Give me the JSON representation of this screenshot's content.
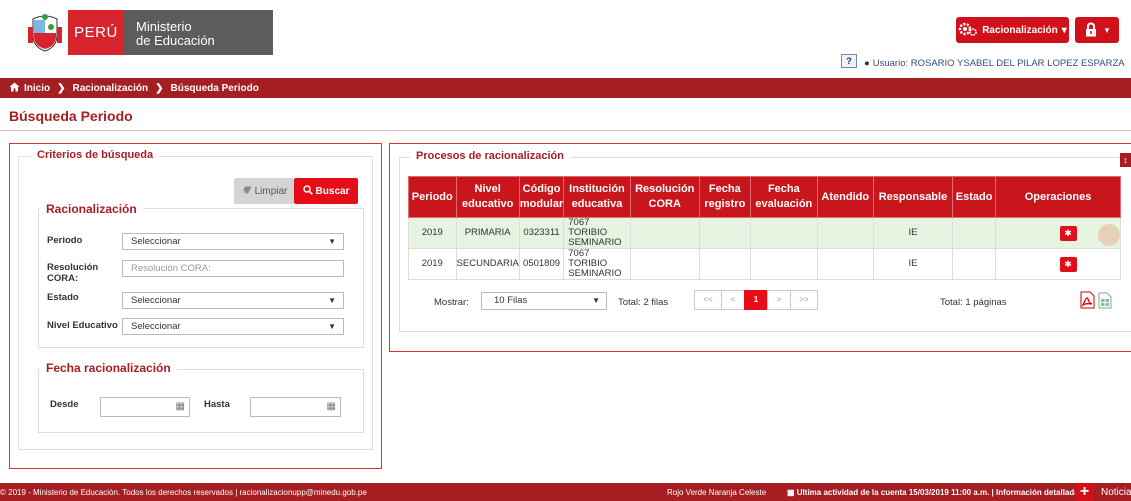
{
  "header": {
    "logo_country": "PERÚ",
    "logo_ministry_line1": "Ministerio",
    "logo_ministry_line2": "de Educación",
    "racionalizacion_menu": "Racionalización",
    "help_label": "?",
    "user_label": "Usuario: ROSARIO YSABEL DEL PILAR LOPEZ ESPARZA"
  },
  "breadcrumb": [
    "Inicio",
    "Racionalización",
    "Búsqueda Periodo"
  ],
  "page_title": "Búsqueda Periodo",
  "criteria": {
    "legend": "Criterios de búsqueda",
    "clear_label": "Limpiar",
    "search_label": "Buscar",
    "racionalizacion_legend": "Racionalización",
    "periodo_label": "Periodo",
    "periodo_value": "Seleccionar",
    "resolucion_label_1": "Resolución",
    "resolucion_label_2": "CORA:",
    "resolucion_placeholder": "Resolución CORA:",
    "estado_label": "Estado",
    "estado_value": "Seleccionar",
    "nivel_label": "Nivel Educativo",
    "nivel_value": "Seleccionar",
    "fecha_legend": "Fecha racionalización",
    "desde_label": "Desde",
    "hasta_label": "Hasta"
  },
  "processes": {
    "legend": "Procesos de racionalización",
    "columns": [
      [
        "Periodo"
      ],
      [
        "Nivel",
        "educativo"
      ],
      [
        "Código",
        "modular"
      ],
      [
        "Institución",
        "educativa"
      ],
      [
        "Resolución",
        "CORA"
      ],
      [
        "Fecha",
        "registro"
      ],
      [
        "Fecha",
        "evaluación"
      ],
      [
        "Atendido"
      ],
      [
        "Responsable"
      ],
      [
        "Estado"
      ],
      [
        "Operaciones"
      ]
    ],
    "rows": [
      {
        "periodo": "2019",
        "nivel": "PRIMARIA",
        "codigo": "0323311",
        "inst1": "7067 TORIBIO",
        "inst2": "SEMINARIO",
        "resolucion": "",
        "fecha_registro": "",
        "fecha_evaluacion": "",
        "atendido": "",
        "responsable": "IE",
        "estado": ""
      },
      {
        "periodo": "2019",
        "nivel": "SECUNDARIA",
        "codigo": "0501809",
        "inst1": "7067 TORIBIO",
        "inst2": "SEMINARIO",
        "resolucion": "",
        "fecha_registro": "",
        "fecha_evaluacion": "",
        "atendido": "",
        "responsable": "IE",
        "estado": ""
      }
    ],
    "mostrar_label": "Mostrar:",
    "page_size": "10 Filas",
    "total_rows": "Total: 2 filas",
    "pager": {
      "first": "<<",
      "prev": "<",
      "current": "1",
      "next": ">",
      "last": ">>"
    },
    "total_pages": "Total: 1 páginas"
  },
  "footer": {
    "copyright": "© 2019 - Ministerio de Educación. Todos los derechos reservados  |  racionalizacionupp@minedu.gob.pe",
    "themes": "Rojo Verde Naranja Celeste",
    "last_activity": "Ultima actividad de la cuenta 15/03/2019 11:00 a.m.  |  Información detallada",
    "notifications": "Noticia"
  },
  "colors": {
    "brand_red": "#a51e22",
    "button_red": "#e60d17",
    "highlight_row": "#e5f3e0"
  }
}
